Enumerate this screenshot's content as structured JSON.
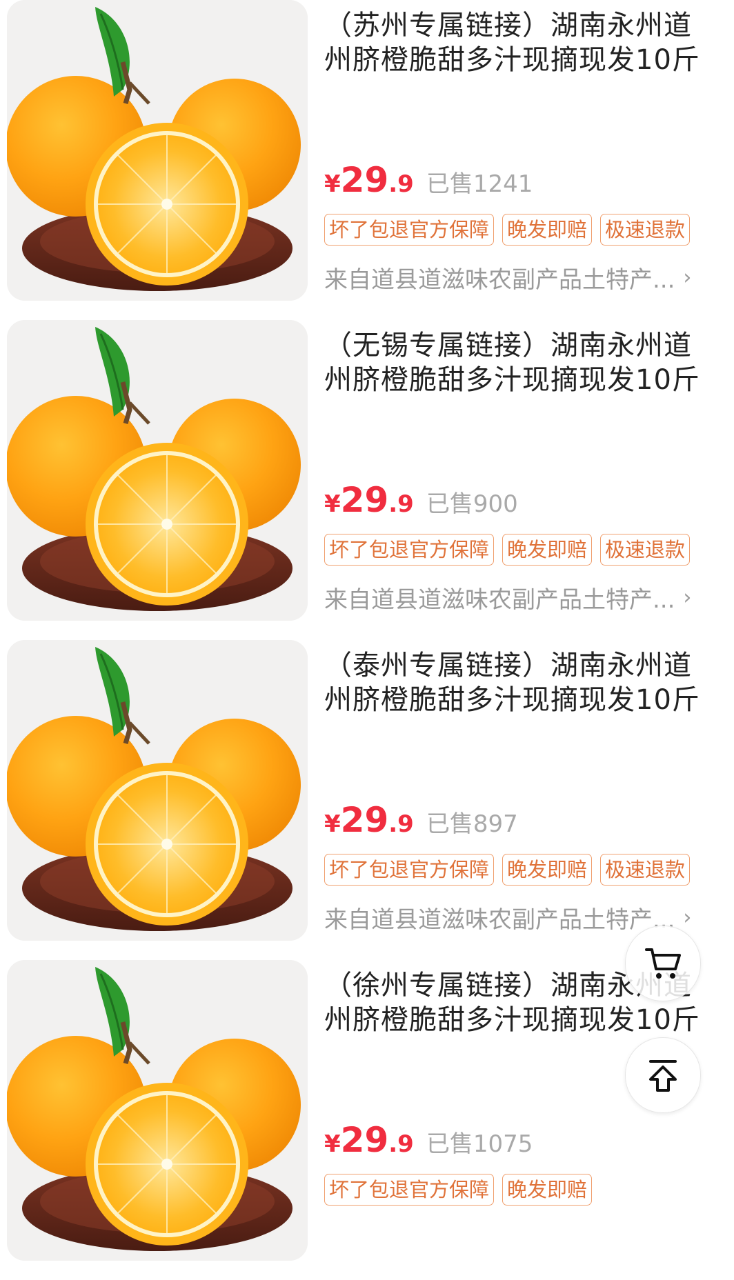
{
  "products": [
    {
      "title": "（苏州专属链接）湖南永州道州脐橙脆甜多汁现摘现发10斤",
      "currency": "¥",
      "price_int": "29",
      "price_dec": ".9",
      "sold_label": "已售",
      "sold_count": "1241",
      "tags": [
        "坏了包退官方保障",
        "晚发即赔",
        "极速退款"
      ],
      "shop": "来自道县道滋味农副产品土特产...",
      "chevron": "›"
    },
    {
      "title": "（无锡专属链接）湖南永州道州脐橙脆甜多汁现摘现发10斤",
      "currency": "¥",
      "price_int": "29",
      "price_dec": ".9",
      "sold_label": "已售",
      "sold_count": "900",
      "tags": [
        "坏了包退官方保障",
        "晚发即赔",
        "极速退款"
      ],
      "shop": "来自道县道滋味农副产品土特产...",
      "chevron": "›"
    },
    {
      "title": "（泰州专属链接）湖南永州道州脐橙脆甜多汁现摘现发10斤",
      "currency": "¥",
      "price_int": "29",
      "price_dec": ".9",
      "sold_label": "已售",
      "sold_count": "897",
      "tags": [
        "坏了包退官方保障",
        "晚发即赔",
        "极速退款"
      ],
      "shop": "来自道县道滋味农副产品土特产...",
      "chevron": "›"
    },
    {
      "title": "（徐州专属链接）湖南永州道州脐橙脆甜多汁现摘现发10斤",
      "currency": "¥",
      "price_int": "29",
      "price_dec": ".9",
      "sold_label": "已售",
      "sold_count": "1075",
      "tags": [
        "坏了包退官方保障",
        "晚发即赔"
      ],
      "shop": "",
      "chevron": ""
    }
  ],
  "floating": {
    "cart_icon": "cart-icon",
    "back_to_top_icon": "arrow-up-icon"
  },
  "colors": {
    "price": "#f02d3f",
    "tag_border": "#f0a06f",
    "tag_text": "#e0733a",
    "muted": "#9a9a9a"
  }
}
